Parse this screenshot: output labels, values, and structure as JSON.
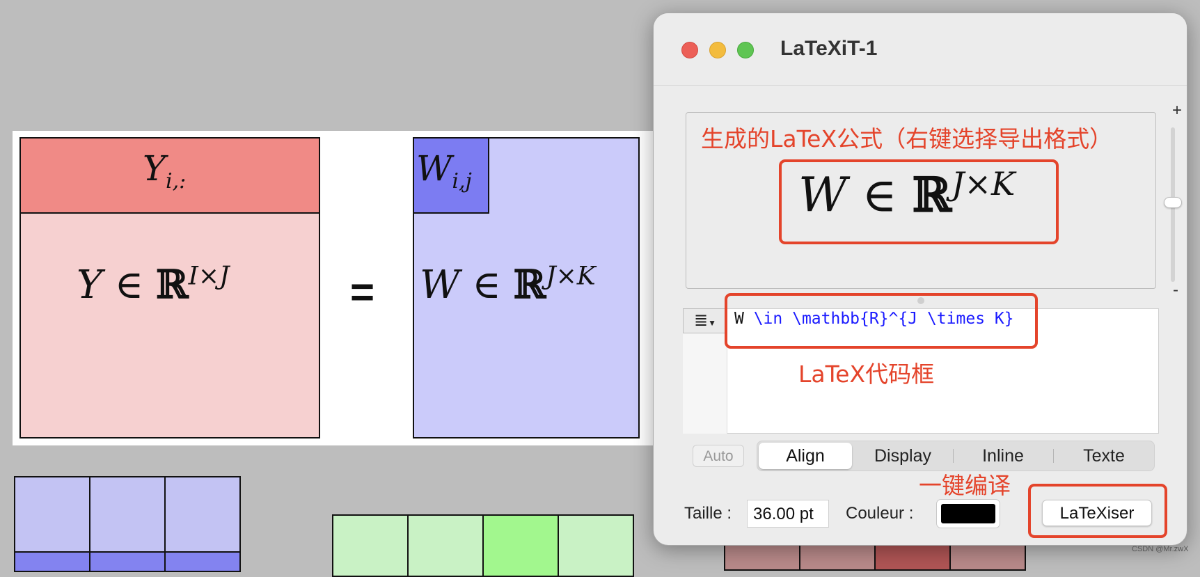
{
  "background": {
    "y_matrix": {
      "header_sub": "i,:",
      "header_var": "Y",
      "body_var": "Y",
      "in": "∈",
      "R": "ℝ",
      "sup": "I×J"
    },
    "equals": "=",
    "w_matrix": {
      "cell_var": "W",
      "cell_sub": "i,j",
      "body_var": "W",
      "in": "∈",
      "R": "ℝ",
      "sup": "J×K"
    }
  },
  "window": {
    "title": "LaTeXiT-1",
    "preview": {
      "annotation": "生成的LaTeX公式（右键选择导出格式）",
      "formula_var": "W",
      "formula_in": "∈",
      "formula_R": "ℝ",
      "formula_sup": "J×K"
    },
    "zoom": {
      "plus": "+",
      "minus": "-"
    },
    "editor": {
      "code_plain": "W ",
      "code_command": "\\in \\mathbb{R}^{J \\times K}",
      "annotation": "LaTeX代码框",
      "menu_icon": "≣"
    },
    "modes": {
      "auto": "Auto",
      "options": [
        "Align",
        "Display",
        "Inline",
        "Texte"
      ],
      "selected": "Align"
    },
    "compile_annotation": "一键编译",
    "taille_label": "Taille :",
    "taille_value": "36.00 pt",
    "couleur_label": "Couleur :",
    "color_value": "#000000",
    "latexiser_label": "LaTeXiser"
  },
  "watermark": "CSDN @Mr.zwX",
  "colors": {
    "accent_annotation": "#e4442b",
    "code_blue": "#1a1aff"
  }
}
